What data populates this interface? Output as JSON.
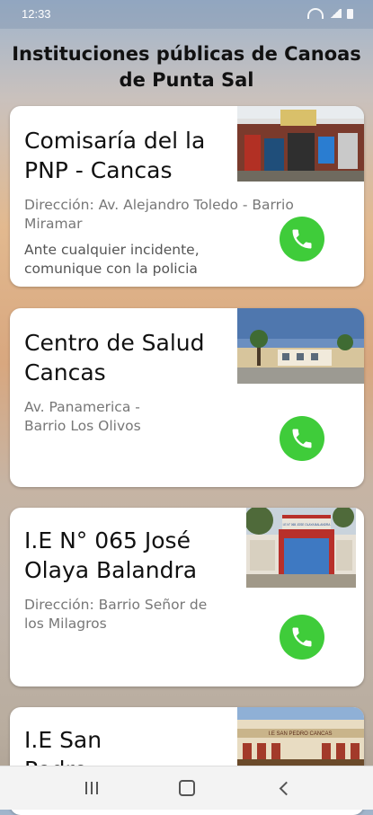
{
  "status_bar": {
    "time": "12:33"
  },
  "header": {
    "title": "Instituciones públicas de Canoas de Punta Sal"
  },
  "cards": [
    {
      "title": "Comisaría del la PNP - Cancas",
      "address": "Dirección: Av. Alejandro Toledo - Barrio Miramar",
      "note": "Ante cualquier incidente, comunique con la policia"
    },
    {
      "title": "Centro de Salud Cancas",
      "address": "Av. Panamerica - Barrio Los Olivos"
    },
    {
      "title": "I.E N° 065 José Olaya Balandra",
      "address": "Dirección: Barrio Señor de los Milagros"
    },
    {
      "title": "I.E San Pedro"
    }
  ],
  "photos": {
    "card3_sign": "I.E N° 065 JOSE OLAYA BALANDRA",
    "card4_sign": "I.E SAN PEDRO CANCAS"
  },
  "icons": {
    "call": "phone-icon",
    "nav_recents": "recents-icon",
    "nav_home": "home-icon",
    "nav_back": "back-icon"
  },
  "colors": {
    "call_button": "#3fcc3a",
    "card_background": "#ffffff",
    "title_text": "#111111",
    "address_text": "#777777"
  }
}
